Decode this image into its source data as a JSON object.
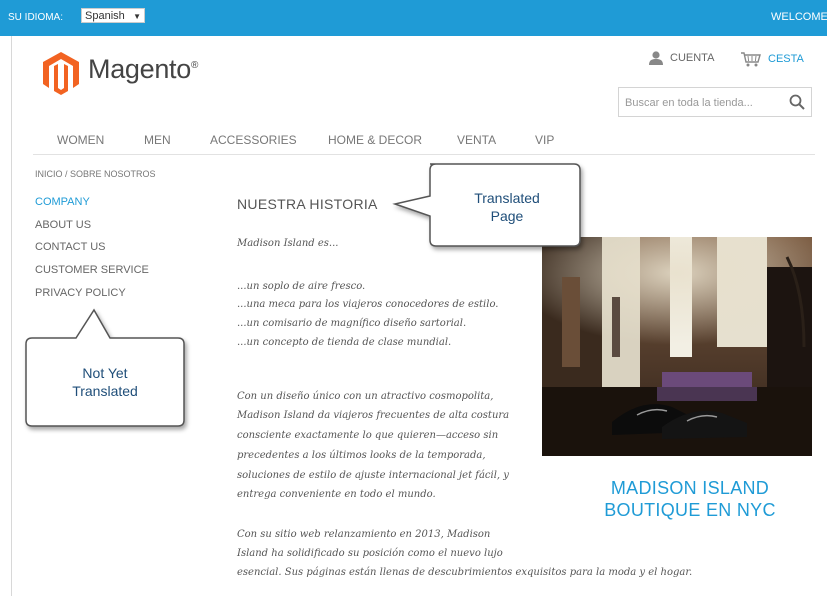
{
  "topbar": {
    "lang_label": "SU IDIOMA:",
    "lang_value": "Spanish",
    "welcome": "WELCOME"
  },
  "header": {
    "logo": "Magento",
    "logo_mark": "®",
    "account": "CUENTA",
    "cart": "CESTA",
    "search_placeholder": "Buscar en toda la tienda..."
  },
  "nav": {
    "items": [
      {
        "label": "WOMEN"
      },
      {
        "label": "MEN"
      },
      {
        "label": "ACCESSORIES"
      },
      {
        "label": "HOME & DECOR"
      },
      {
        "label": "VENTA"
      },
      {
        "label": "VIP"
      }
    ]
  },
  "breadcrumb": "INICIO / SOBRE NOSOTROS",
  "sidebar": {
    "items": [
      {
        "label": "COMPANY"
      },
      {
        "label": "ABOUT US"
      },
      {
        "label": "CONTACT US"
      },
      {
        "label": "CUSTOMER SERVICE"
      },
      {
        "label": "PRIVACY POLICY"
      }
    ]
  },
  "main": {
    "title": "NUESTRA HISTORIA",
    "lines": [
      "Madison Island es...",
      "...un soplo de aire fresco.",
      "...una meca para los viajeros conocedores de estilo.",
      "...un comisario de magnífico diseño sartorial.",
      "...un concepto de tienda de clase mundial.",
      "Con un diseño único con un atractivo cosmopolita,",
      "Madison Island da viajeros frecuentes de alta costura",
      "consciente exactamente lo que quieren—acceso sin",
      "precedentes a los últimos looks de la temporada,",
      "soluciones de estilo de ajuste internacional jet fácil, y",
      "entrega conveniente en todo el mundo.",
      "Con su sitio web relanzamiento en 2013, Madison",
      "Island ha solidificado su posición como el nuevo lujo",
      "esencial. Sus páginas están llenas de descubrimientos exquisitos para la moda y el hogar."
    ],
    "promo_line1": "MADISON ISLAND",
    "promo_line2": "BOUTIQUE EN NYC"
  },
  "callouts": {
    "translated_line1": "Translated",
    "translated_line2": "Page",
    "not_translated_line1": "Not Yet",
    "not_translated_line2": "Translated"
  },
  "colors": {
    "brand_blue": "#1f9bd6",
    "logo_orange": "#f26322"
  }
}
